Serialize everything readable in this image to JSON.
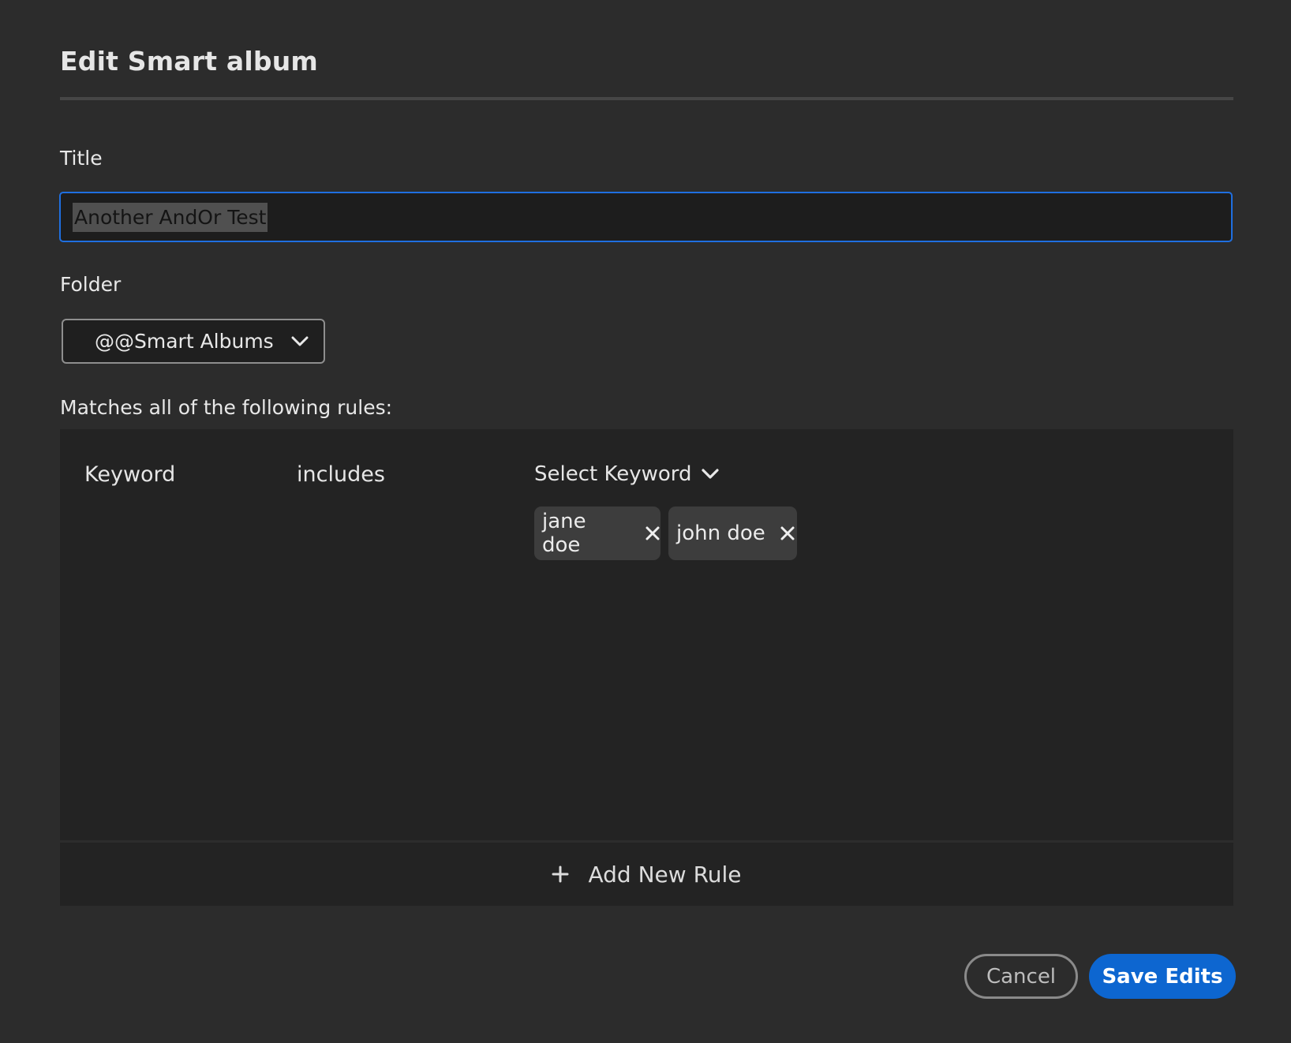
{
  "dialog": {
    "title": "Edit Smart album"
  },
  "title_field": {
    "label": "Title",
    "value": "Another AndOr Test"
  },
  "folder_field": {
    "label": "Folder",
    "selected": "@@Smart Albums",
    "icon": "chevron-down-icon"
  },
  "rules": {
    "heading": "Matches all of the following rules:",
    "items": [
      {
        "field": "Keyword",
        "operator": "includes",
        "value_picker": "Select Keyword",
        "tags": [
          {
            "label": "jane doe",
            "icon": "close-icon"
          },
          {
            "label": "john doe",
            "icon": "close-icon"
          }
        ]
      }
    ],
    "add_rule_label": "Add New Rule",
    "add_rule_icon": "plus-icon"
  },
  "actions": {
    "cancel_label": "Cancel",
    "save_label": "Save Edits"
  },
  "colors": {
    "background": "#2c2c2c",
    "panel": "#232323",
    "accent": "#0d66d0",
    "focus_border": "#1f6fe0"
  }
}
